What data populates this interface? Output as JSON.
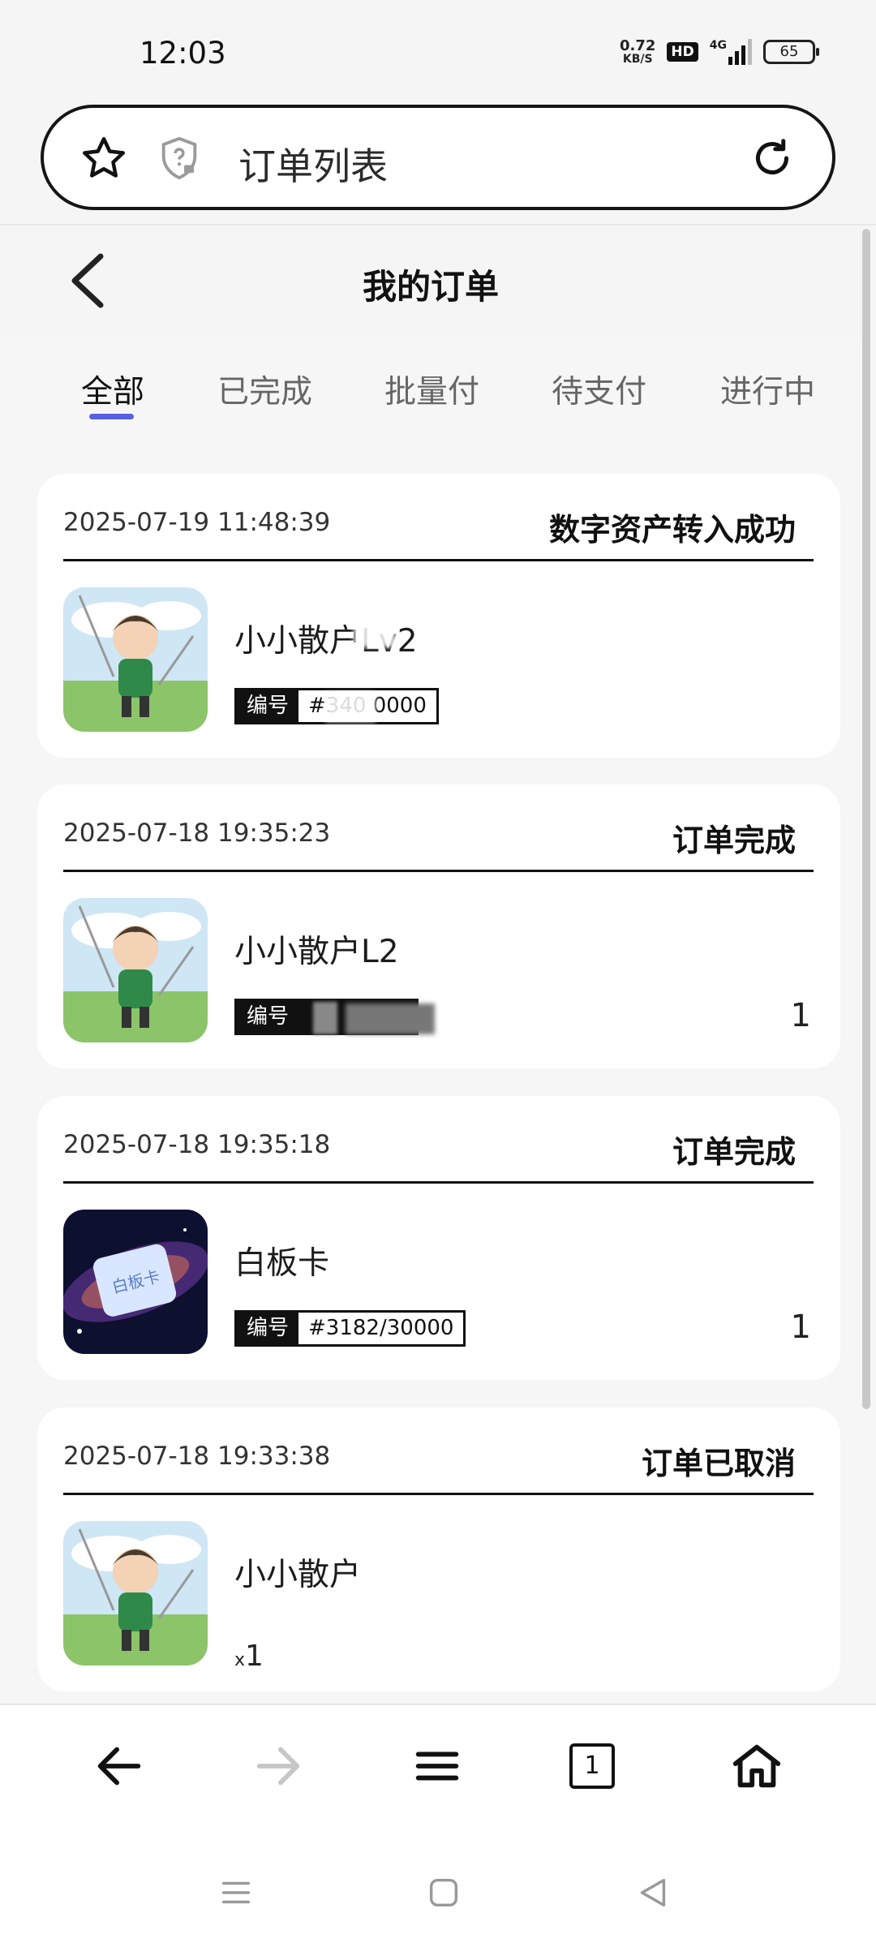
{
  "status_bar": {
    "time": "12:03",
    "net_speed_value": "0.72",
    "net_speed_unit": "KB/S",
    "hd_badge": "HD",
    "network": "4G",
    "battery": "65"
  },
  "url_bar": {
    "title": "订单列表",
    "star_icon": "star-icon",
    "security_icon": "shield-question-icon",
    "refresh_icon": "refresh-icon"
  },
  "header": {
    "title": "我的订单",
    "back_icon": "chevron-left-icon"
  },
  "tabs": [
    {
      "label": "全部",
      "active": true
    },
    {
      "label": "已完成",
      "active": false
    },
    {
      "label": "批量付",
      "active": false
    },
    {
      "label": "待支付",
      "active": false
    },
    {
      "label": "进行中",
      "active": false
    }
  ],
  "orders": [
    {
      "time": "2025-07-19 11:48:39",
      "status": "数字资产转入成功",
      "name": "小小散户Lv2",
      "serial_label": "编号",
      "serial_value": "#340   0000",
      "quantity": ""
    },
    {
      "time": "2025-07-18 19:35:23",
      "status": "订单完成",
      "name": "小小散户L2",
      "serial_label": "编号",
      "serial_value": "",
      "quantity": "1"
    },
    {
      "time": "2025-07-18 19:35:18",
      "status": "订单完成",
      "name": "白板卡",
      "serial_label": "编号",
      "serial_value": "#3182/30000",
      "quantity": "1",
      "thumb_text": "白板卡"
    },
    {
      "time": "2025-07-18 19:33:38",
      "status": "订单已取消",
      "name": "小小散户",
      "quantity_prefix": "x",
      "quantity": "1"
    }
  ],
  "bottom_nav": [
    "back-arrow-icon",
    "forward-arrow-icon",
    "menu-icon",
    "tabs-icon",
    "home-icon"
  ],
  "bottom_nav_tab_count": "1",
  "system_nav": [
    "recents-icon",
    "home-square-icon",
    "back-triangle-icon"
  ],
  "colors": {
    "accent": "#5a5fe0",
    "page_bg": "#f6f6f7",
    "card_bg": "#ffffff"
  }
}
